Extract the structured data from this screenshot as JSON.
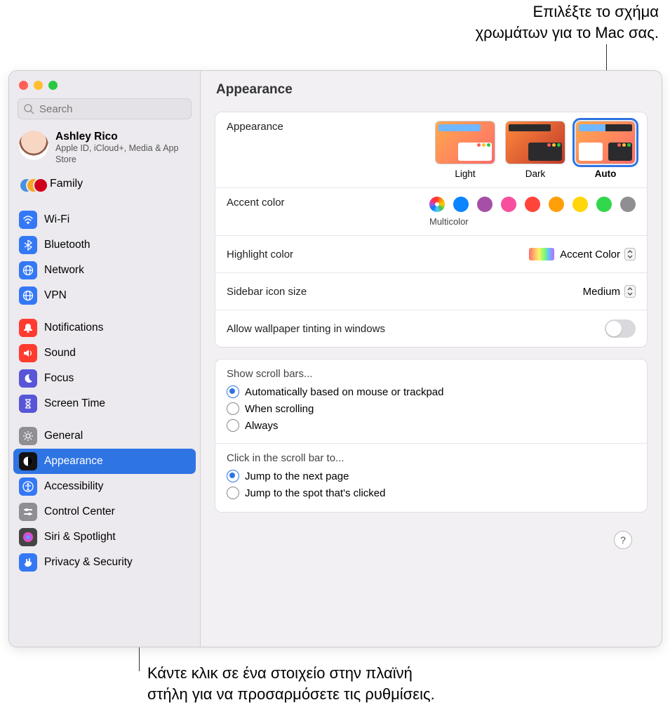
{
  "callouts": {
    "top": "Επιλέξτε το σχήμα\nχρωμάτων για το Mac σας.",
    "bottom": "Κάντε κλικ σε ένα στοιχείο στην πλαϊνή\nστήλη για να προσαρμόσετε τις ρυθμίσεις."
  },
  "sidebar": {
    "search_placeholder": "Search",
    "account_name": "Ashley Rico",
    "account_sub": "Apple ID, iCloud+, Media & App Store",
    "family_label": "Family",
    "sections": [
      [
        {
          "label": "Wi-Fi",
          "color": "#3478f6",
          "icon": "wifi"
        },
        {
          "label": "Bluetooth",
          "color": "#3478f6",
          "icon": "bluetooth"
        },
        {
          "label": "Network",
          "color": "#3478f6",
          "icon": "globe"
        },
        {
          "label": "VPN",
          "color": "#3478f6",
          "icon": "globe"
        }
      ],
      [
        {
          "label": "Notifications",
          "color": "#ff3b30",
          "icon": "bell"
        },
        {
          "label": "Sound",
          "color": "#ff3b30",
          "icon": "speaker"
        },
        {
          "label": "Focus",
          "color": "#5856d6",
          "icon": "moon"
        },
        {
          "label": "Screen Time",
          "color": "#5856d6",
          "icon": "hourglass"
        }
      ],
      [
        {
          "label": "General",
          "color": "#8e8e93",
          "icon": "gear"
        },
        {
          "label": "Appearance",
          "color": "#131313",
          "icon": "appearance",
          "selected": true
        },
        {
          "label": "Accessibility",
          "color": "#3478f6",
          "icon": "accessibility"
        },
        {
          "label": "Control Center",
          "color": "#8e8e93",
          "icon": "sliders"
        },
        {
          "label": "Siri & Spotlight",
          "color": "#444",
          "icon": "siri"
        },
        {
          "label": "Privacy & Security",
          "color": "#3478f6",
          "icon": "hand"
        }
      ]
    ]
  },
  "main": {
    "title": "Appearance",
    "appearance_label": "Appearance",
    "appearance_options": [
      "Light",
      "Dark",
      "Auto"
    ],
    "appearance_selected": 2,
    "accent_label": "Accent color",
    "accent_sub": "Multicolor",
    "accent_colors": [
      "multicolor",
      "#0a84ff",
      "#a550a7",
      "#f74f9e",
      "#ff453a",
      "#ff9f0a",
      "#ffd60a",
      "#32d74b",
      "#8e8e93"
    ],
    "accent_selected": 0,
    "highlight_label": "Highlight color",
    "highlight_value": "Accent Color",
    "icon_size_label": "Sidebar icon size",
    "icon_size_value": "Medium",
    "tinting_label": "Allow wallpaper tinting in windows",
    "scrollbars_heading": "Show scroll bars...",
    "scrollbars_options": [
      "Automatically based on mouse or trackpad",
      "When scrolling",
      "Always"
    ],
    "scrollbars_selected": 0,
    "click_heading": "Click in the scroll bar to...",
    "click_options": [
      "Jump to the next page",
      "Jump to the spot that's clicked"
    ],
    "click_selected": 0,
    "help_label": "?"
  }
}
